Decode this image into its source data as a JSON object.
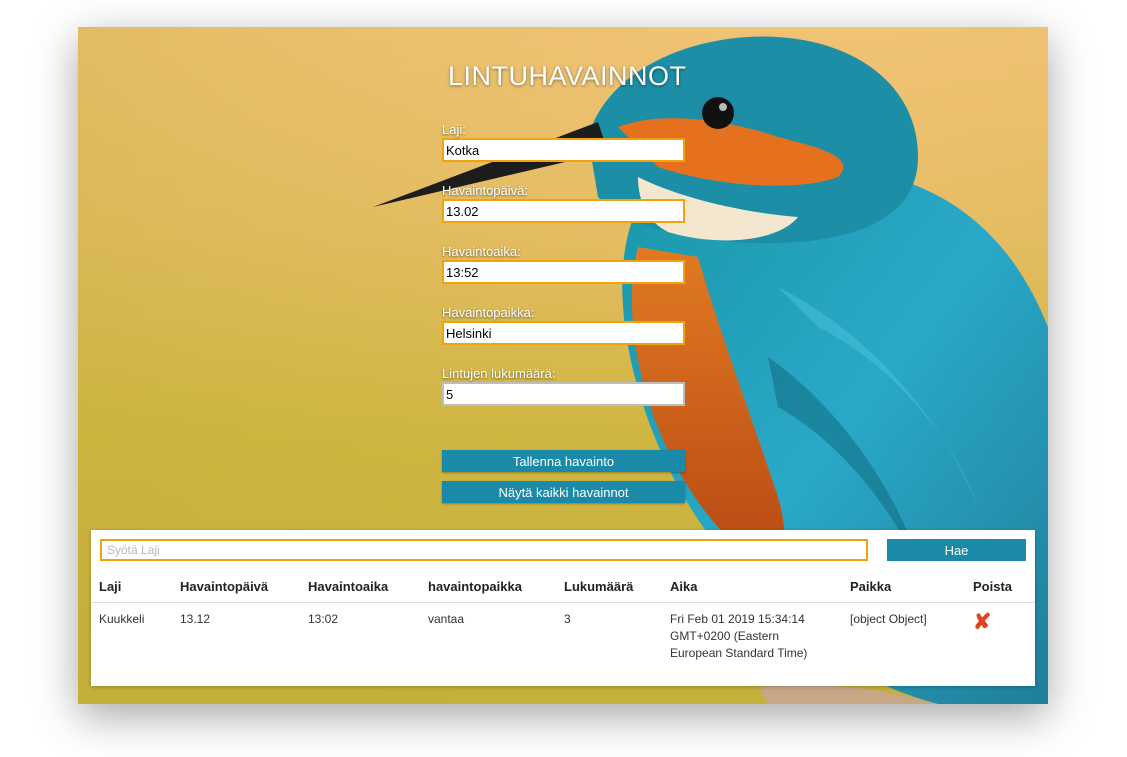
{
  "app": {
    "title": "LINTUHAVAINNOT"
  },
  "form": {
    "species": {
      "label": "Laji:",
      "value": "Kotka"
    },
    "date": {
      "label": "Havaintopäivä:",
      "value": "13.02"
    },
    "time": {
      "label": "Havaintoaika:",
      "value": "13:52"
    },
    "place": {
      "label": "Havaintopaikka:",
      "value": "Helsinki"
    },
    "count": {
      "label": "Lintujen lukumäärä:",
      "value": "5"
    },
    "save_label": "Tallenna havainto",
    "show_all_label": "Näytä kaikki havainnot"
  },
  "search": {
    "placeholder": "Syötä Laji",
    "value": "",
    "button_label": "Hae"
  },
  "table": {
    "headers": [
      "Laji",
      "Havaintopäivä",
      "Havaintoaika",
      "havaintopaikka",
      "Lukumäärä",
      "Aika",
      "Paikka",
      "Poista"
    ],
    "rows": [
      {
        "species": "Kuukkeli",
        "date": "13.12",
        "time": "13:02",
        "place": "vantaa",
        "count": "3",
        "timestamp": "Fri Feb 01 2019 15:34:14 GMT+0200 (Eastern European Standard Time)",
        "location": "[object Object]",
        "delete_icon": "x-icon"
      }
    ]
  },
  "colors": {
    "accent": "#1a8aa8",
    "input_border": "#f0a30a",
    "delete": "#e0461c"
  }
}
